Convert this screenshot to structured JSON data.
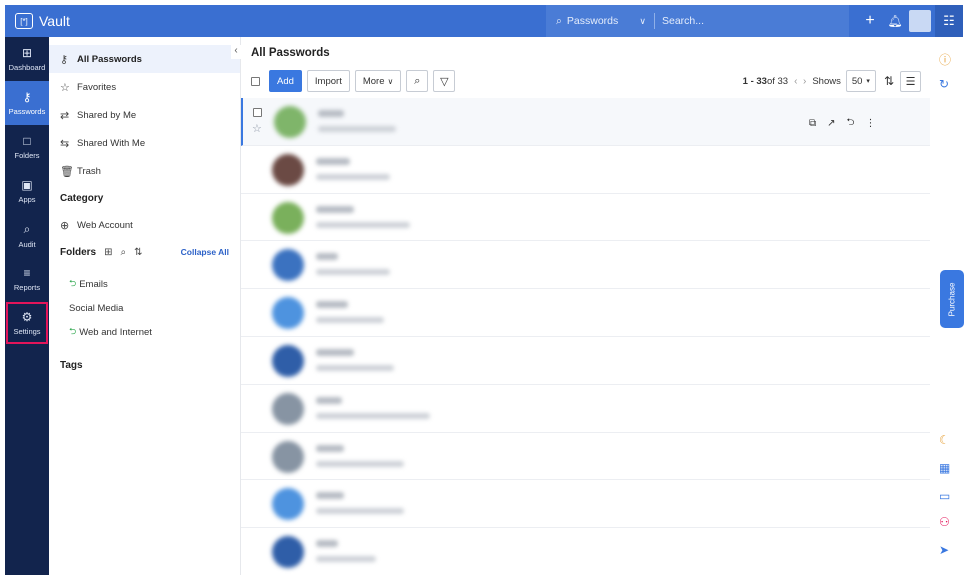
{
  "app": {
    "title": "Vault"
  },
  "topbar": {
    "search_scope": "Passwords",
    "search_placeholder": "Search..."
  },
  "rail": {
    "items": [
      {
        "label": "Dashboard",
        "icon": "dashboard-grid-icon"
      },
      {
        "label": "Passwords",
        "icon": "key-icon"
      },
      {
        "label": "Folders",
        "icon": "folder-icon"
      },
      {
        "label": "Apps",
        "icon": "apps-icon"
      },
      {
        "label": "Audit",
        "icon": "audit-icon"
      },
      {
        "label": "Reports",
        "icon": "reports-icon"
      },
      {
        "label": "Settings",
        "icon": "gear-icon"
      }
    ]
  },
  "nav": {
    "items": [
      {
        "label": "All Passwords"
      },
      {
        "label": "Favorites"
      },
      {
        "label": "Shared by Me"
      },
      {
        "label": "Shared With Me"
      },
      {
        "label": "Trash"
      }
    ],
    "category_heading": "Category",
    "category_items": [
      {
        "label": "Web Account"
      }
    ],
    "folders_heading": "Folders",
    "collapse_all": "Collapse All",
    "folder_items": [
      {
        "label": "Emails",
        "shared": true
      },
      {
        "label": "Social Media",
        "shared": false
      },
      {
        "label": "Web and Internet",
        "shared": true
      }
    ],
    "tags_heading": "Tags"
  },
  "main": {
    "title": "All Passwords",
    "toolbar": {
      "add": "Add",
      "import": "Import",
      "more": "More",
      "range": "1 - 33",
      "of_total": " of 33",
      "shows_label": "Shows",
      "page_size": "50"
    },
    "rows": [
      {
        "avatar_color": "#7fb56a"
      },
      {
        "avatar_color": "#6b4a44"
      },
      {
        "avatar_color": "#7ab05c"
      },
      {
        "avatar_color": "#3b72c0"
      },
      {
        "avatar_color": "#4e93df"
      },
      {
        "avatar_color": "#2f5ea8"
      },
      {
        "avatar_color": "#8794a3"
      },
      {
        "avatar_color": "#8794a3"
      },
      {
        "avatar_color": "#4e93df"
      },
      {
        "avatar_color": "#2f5ea8"
      }
    ]
  },
  "right_strip": {
    "purchase": "Purchase"
  },
  "colors": {
    "topbar": "#3a6fd1",
    "rail": "#12244d",
    "accent": "#3a78e0",
    "settings_highlight": "#e3155a"
  }
}
